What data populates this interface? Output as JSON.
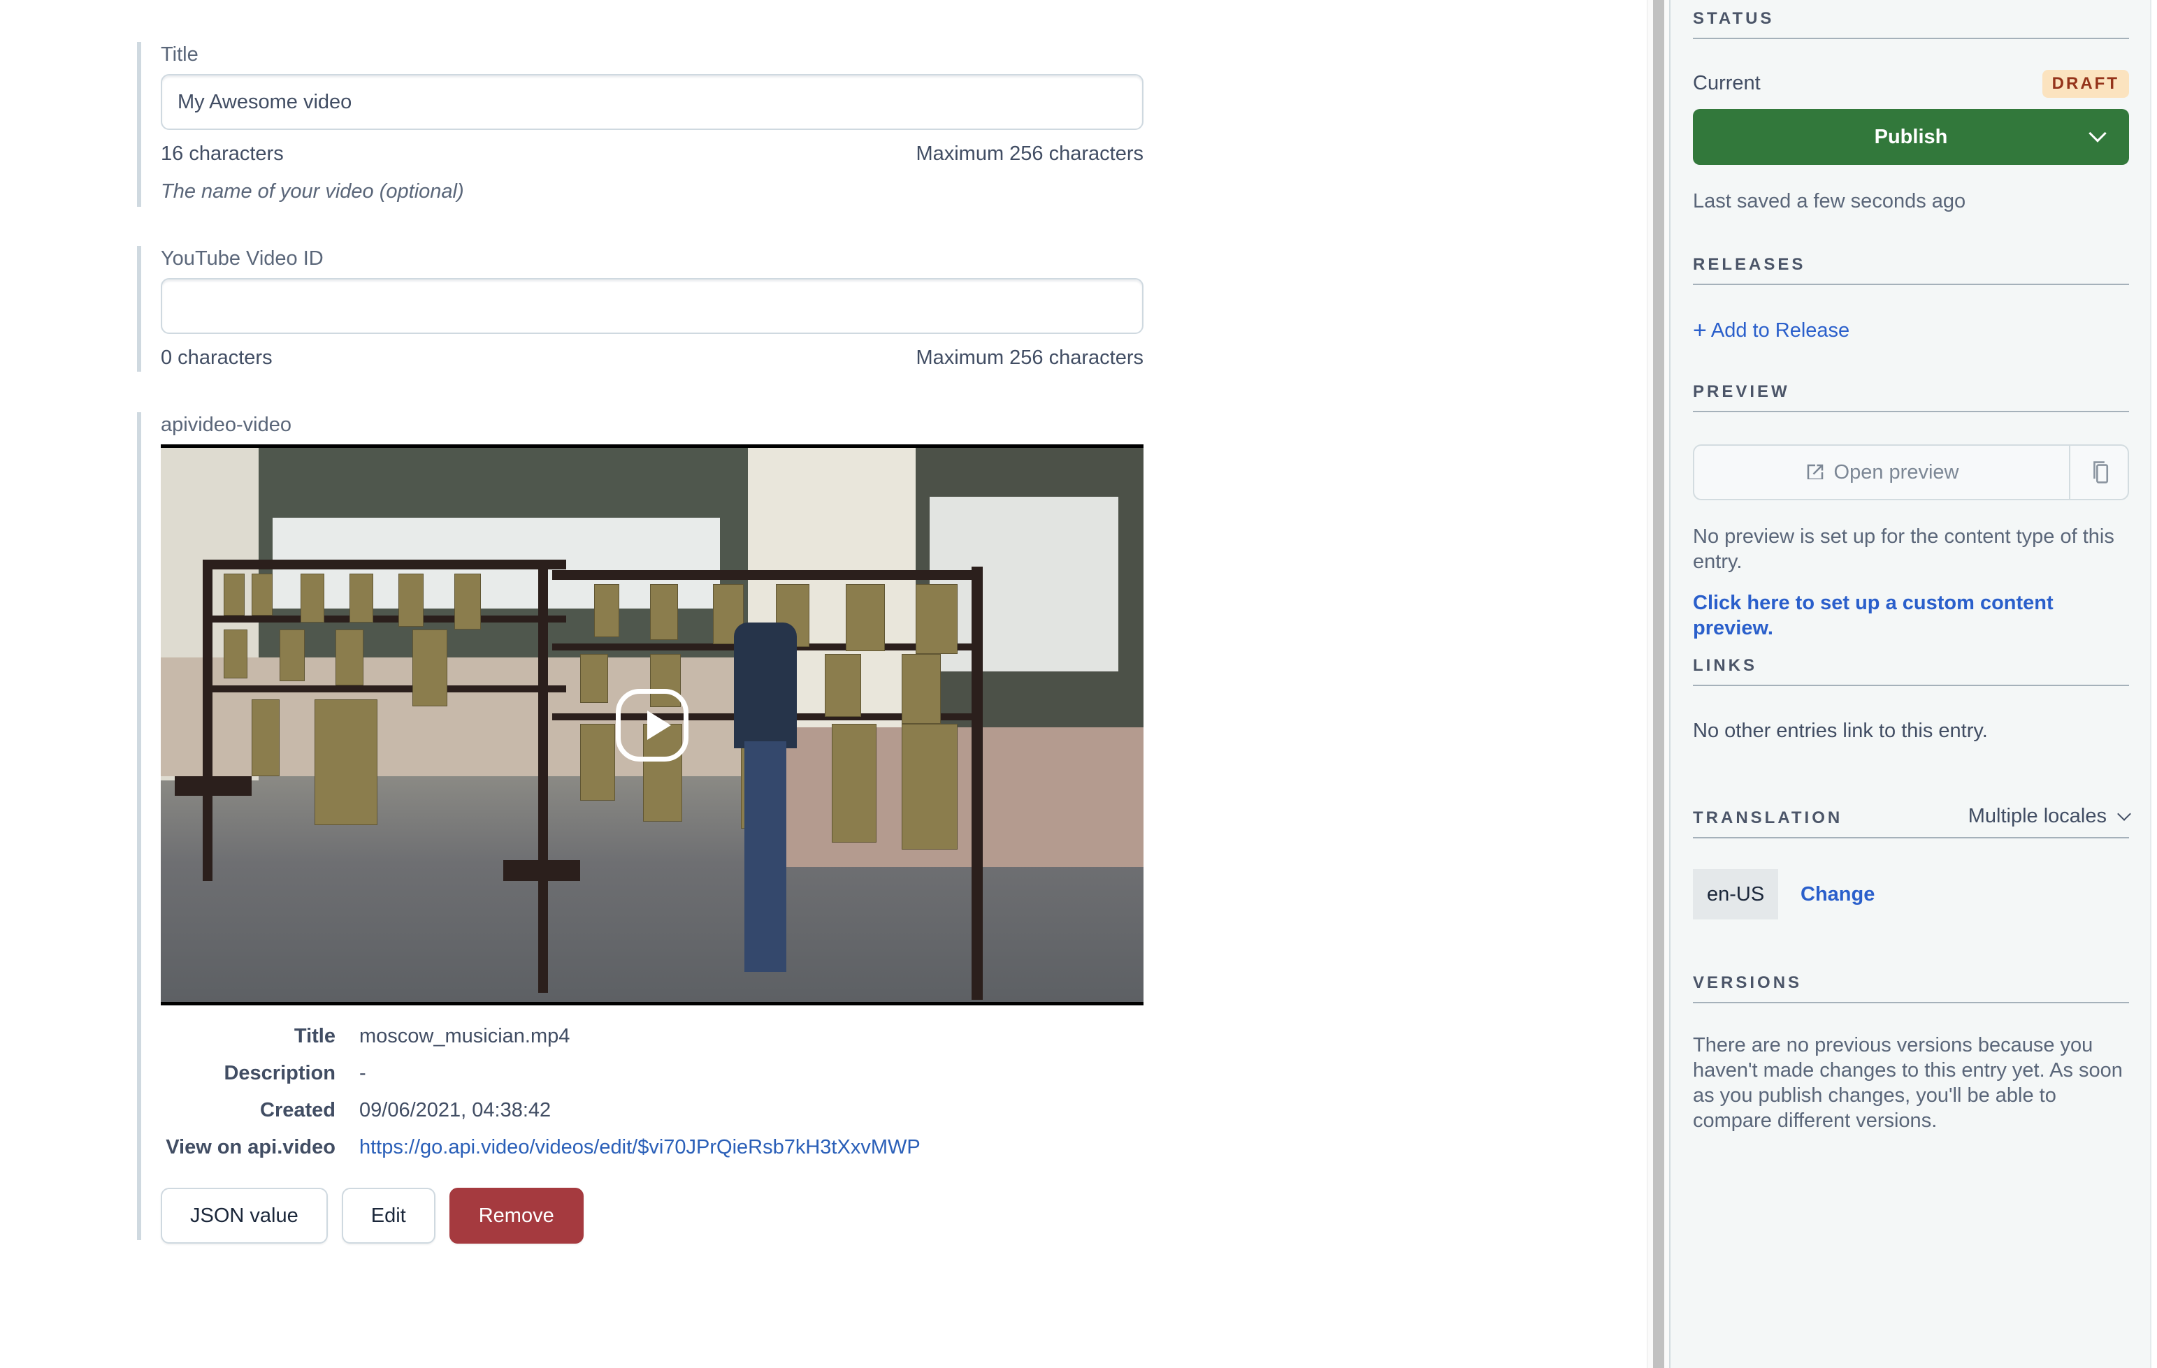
{
  "fields": {
    "title": {
      "label": "Title",
      "value": "My Awesome video",
      "count": "16 characters",
      "max": "Maximum 256 characters",
      "help": "The name of your video (optional)"
    },
    "youtube": {
      "label": "YouTube Video ID",
      "value": "",
      "count": "0 characters",
      "max": "Maximum 256 characters"
    },
    "apivideo": {
      "label": "apivideo-video",
      "meta": [
        {
          "key": "Title",
          "value": "moscow_musician.mp4"
        },
        {
          "key": "Description",
          "value": "-"
        },
        {
          "key": "Created",
          "value": "09/06/2021, 04:38:42"
        },
        {
          "key": "View on api.video",
          "value": "https://go.api.video/videos/edit/$vi70JPrQieRsb7kH3tXxvMWP"
        }
      ],
      "buttons": {
        "json": "JSON value",
        "edit": "Edit",
        "remove": "Remove"
      }
    }
  },
  "sidebar": {
    "status": {
      "heading": "STATUS",
      "current_label": "Current",
      "badge": "DRAFT",
      "publish": "Publish",
      "last_saved": "Last saved a few seconds ago"
    },
    "releases": {
      "heading": "RELEASES",
      "add": "Add to Release"
    },
    "preview": {
      "heading": "PREVIEW",
      "open": "Open preview",
      "note": "No preview is set up for the content type of this entry.",
      "setup_link": "Click here to set up a custom content preview."
    },
    "links": {
      "heading": "LINKS",
      "note": "No other entries link to this entry."
    },
    "translation": {
      "heading": "TRANSLATION",
      "select": "Multiple locales",
      "locale": "en-US",
      "change": "Change"
    },
    "versions": {
      "heading": "VERSIONS",
      "note": "There are no previous versions because you haven't made changes to this entry yet. As soon as you publish changes, you'll be able to compare different versions."
    }
  },
  "colors": {
    "publish": "#32783b",
    "remove": "#a53a3f",
    "link": "#2a5fcb",
    "draft_bg": "#fbe3bf",
    "draft_text": "#94331a"
  }
}
